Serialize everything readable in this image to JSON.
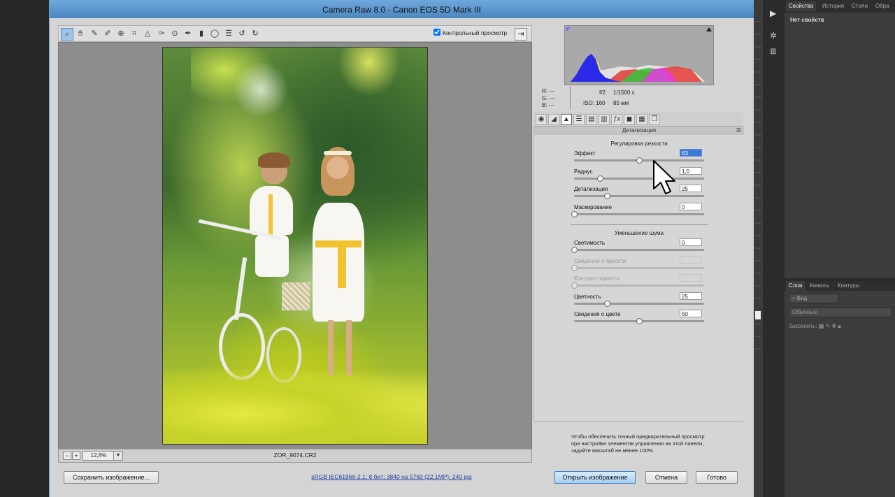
{
  "window": {
    "title": "Camera Raw 8.0  -  Canon EOS 5D Mark III"
  },
  "toolbar": {
    "preview_label": "Контрольный просмотр",
    "preview_checked": true,
    "tools": [
      "zoom-tool",
      "hand-tool",
      "white-balance-tool",
      "color-sampler-tool",
      "target-adjustment-tool",
      "crop-tool",
      "straighten-tool",
      "spot-removal-tool",
      "red-eye-tool",
      "adjustment-brush-tool",
      "graduated-filter-tool",
      "radial-filter-tool",
      "preferences-tool",
      "rotate-ccw-tool",
      "rotate-cw-tool"
    ]
  },
  "preview": {
    "zoom": "12,8%",
    "filename": "ZOR_9074.CR2"
  },
  "info": {
    "r": "R:  ---",
    "g": "G:  ---",
    "b": "B:  ---",
    "aperture": "f/2",
    "shutter": "1/1500 с",
    "iso": "ISO: 160",
    "focal": "85 мм"
  },
  "panel": {
    "title": "Детализация",
    "sharpening": {
      "title": "Регулировка резкости",
      "sliders": [
        {
          "label": "Эффект",
          "value": "63",
          "fraction": 0.5
        },
        {
          "label": "Радиус",
          "value": "1,0",
          "fraction": 0.2
        },
        {
          "label": "Детализация",
          "value": "25",
          "fraction": 0.25
        },
        {
          "label": "Маскирование",
          "value": "0",
          "fraction": 0.0
        }
      ]
    },
    "noise": {
      "title": "Уменьшение шума",
      "sliders": [
        {
          "label": "Светимость",
          "value": "0",
          "fraction": 0.0,
          "disabled": false
        },
        {
          "label": "Сведения о яркости",
          "value": "",
          "fraction": 0.0,
          "disabled": true
        },
        {
          "label": "Контраст яркости",
          "value": "",
          "fraction": 0.0,
          "disabled": true
        },
        {
          "label": "Цветность",
          "value": "25",
          "fraction": 0.25,
          "disabled": false
        },
        {
          "label": "Сведения о цвете",
          "value": "50",
          "fraction": 0.5,
          "disabled": false
        }
      ]
    },
    "hint": "Чтобы обеспечить точный предварительный просмотр при настройке элементов управления на этой панели, задайте масштаб не менее 100%."
  },
  "footer": {
    "save_label": "Сохранить изображение...",
    "workflow_link": "sRGB IEC61966-2.1; 8 бит; 3840 на 5760 (22,1MP); 240 ppi",
    "open_label": "Открыть изображение",
    "cancel_label": "Отмена",
    "done_label": "Готово"
  },
  "photoshop": {
    "top_tabs": [
      "Свойства",
      "История",
      "Стили",
      "Обра"
    ],
    "properties_text": "Нет свойств",
    "layer_tabs": [
      "Слои",
      "Каналы",
      "Контуры"
    ],
    "kind_label": "Вид",
    "blend_mode": "Обычные",
    "lock_label": "Закрепить:"
  }
}
